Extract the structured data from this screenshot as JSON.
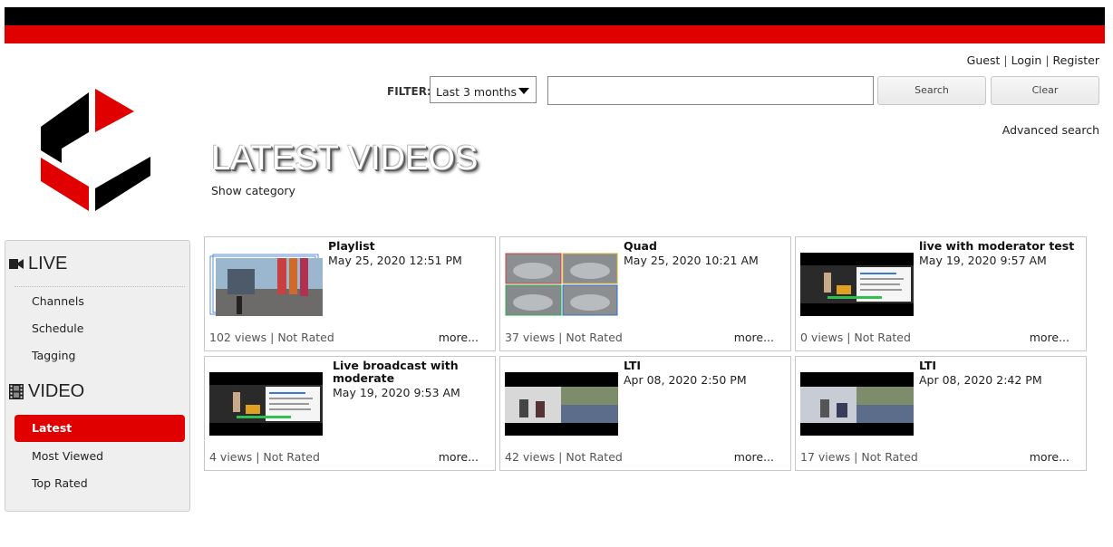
{
  "header": {
    "user_links": {
      "guest": "Guest",
      "login": "Login",
      "register": "Register"
    },
    "filter_label": "FILTER:",
    "filter_value": "Last 3 months",
    "search_button": "Search",
    "clear_button": "Clear",
    "advanced_search": "Advanced search",
    "brand_colors": {
      "red": "#e00000",
      "black": "#000000"
    }
  },
  "main": {
    "title": "LATEST VIDEOS",
    "show_category": "Show category"
  },
  "sidebar": {
    "live_heading": "LIVE",
    "live_icon": "video-camera-icon",
    "live_items": [
      "Channels",
      "Schedule",
      "Tagging"
    ],
    "video_heading": "VIDEO",
    "video_icon": "film-icon",
    "video_items": [
      "Latest",
      "Most Viewed",
      "Top Rated"
    ],
    "active_item": "Latest"
  },
  "videos": [
    {
      "title": "Playlist",
      "date": "May 25, 2020 12:51 PM",
      "views": "102 views",
      "rating": "Not Rated",
      "more": "more...",
      "thumb": "playlist"
    },
    {
      "title": "Quad",
      "date": "May 25, 2020 10:21 AM",
      "views": "37 views",
      "rating": "Not Rated",
      "more": "more...",
      "thumb": "quad"
    },
    {
      "title": "live with moderator test",
      "date": "May 19, 2020 9:57 AM",
      "views": "0 views",
      "rating": "Not Rated",
      "more": "more...",
      "thumb": "presenter"
    },
    {
      "title": "Live broadcast with moderate",
      "date": "May 19, 2020 9:53 AM",
      "views": "4 views",
      "rating": "Not Rated",
      "more": "more...",
      "thumb": "presenter"
    },
    {
      "title": "LTI",
      "date": "Apr 08, 2020 2:50 PM",
      "views": "42 views",
      "rating": "Not Rated",
      "more": "more...",
      "thumb": "lti"
    },
    {
      "title": "LTI",
      "date": "Apr 08, 2020 2:42 PM",
      "views": "17 views",
      "rating": "Not Rated",
      "more": "more...",
      "thumb": "lti2"
    }
  ]
}
